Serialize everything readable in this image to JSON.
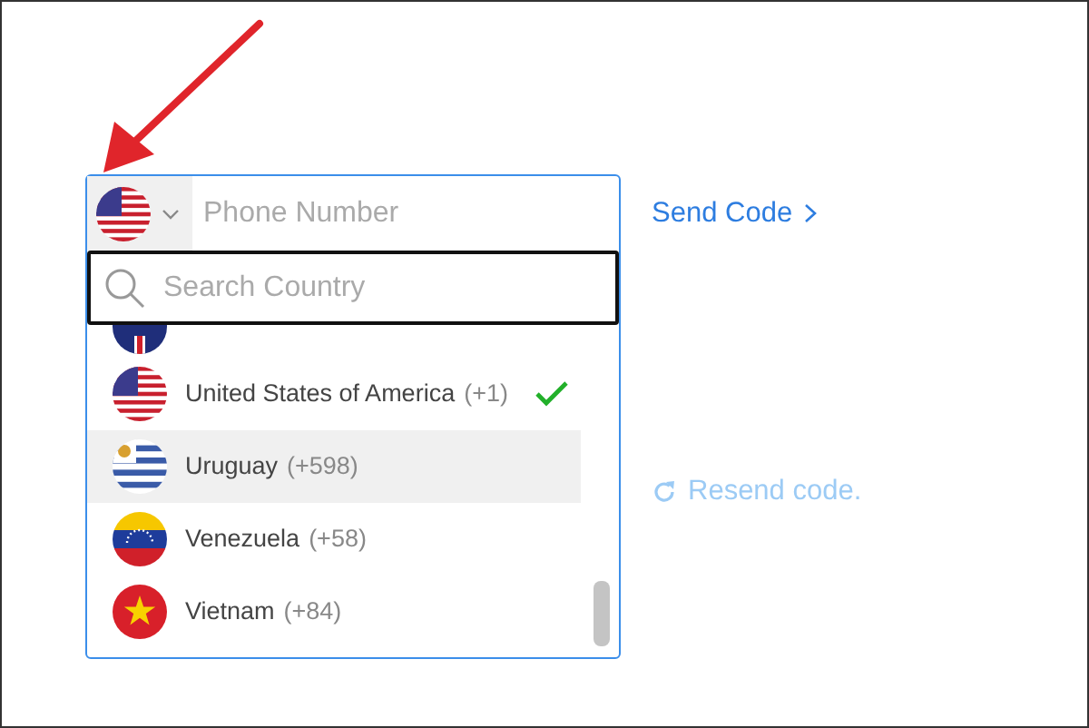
{
  "phone_input": {
    "placeholder": "Phone Number"
  },
  "country_search": {
    "placeholder": "Search Country"
  },
  "countries": [
    {
      "name": "United States of America",
      "code": "(+1)",
      "selected": true,
      "highlighted": false
    },
    {
      "name": "Uruguay",
      "code": "(+598)",
      "selected": false,
      "highlighted": true
    },
    {
      "name": "Venezuela",
      "code": "(+58)",
      "selected": false,
      "highlighted": false
    },
    {
      "name": "Vietnam",
      "code": "(+84)",
      "selected": false,
      "highlighted": false
    }
  ],
  "send_code": "Send Code",
  "resend_code": "Resend code."
}
